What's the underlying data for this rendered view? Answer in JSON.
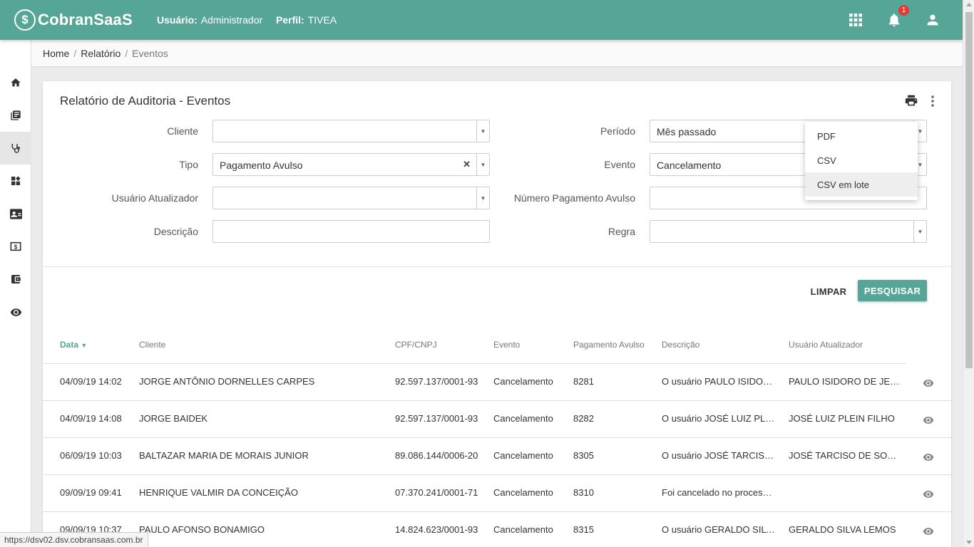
{
  "header": {
    "logo_text": "CobranSaaS",
    "user_label": "Usuário:",
    "user_value": "Administrador",
    "profile_label": "Perfil:",
    "profile_value": "TIVEA",
    "notification_count": "1",
    "color": "#56a697"
  },
  "breadcrumb": {
    "items": [
      "Home",
      "Relatório",
      "Eventos"
    ]
  },
  "sidebar": {
    "icons": [
      "home-icon",
      "book-icon",
      "stethoscope-icon",
      "dashboard-icon",
      "contact-card-icon",
      "money-icon",
      "wallet-icon",
      "eye-icon"
    ],
    "active_index": 2
  },
  "page": {
    "title": "Relatório de Auditoria - Eventos"
  },
  "filters": {
    "cliente": {
      "label": "Cliente",
      "value": ""
    },
    "tipo": {
      "label": "Tipo",
      "value": "Pagamento Avulso"
    },
    "usuario": {
      "label": "Usuário Atualizador",
      "value": ""
    },
    "descricao": {
      "label": "Descrição",
      "value": ""
    },
    "periodo": {
      "label": "Período",
      "value": "Mês passado"
    },
    "evento": {
      "label": "Evento",
      "value": "Cancelamento"
    },
    "numero": {
      "label": "Número Pagamento Avulso",
      "value": ""
    },
    "regra": {
      "label": "Regra",
      "value": ""
    }
  },
  "actions": {
    "clear": "LIMPAR",
    "search": "PESQUISAR"
  },
  "export_menu": {
    "items": [
      "PDF",
      "CSV",
      "CSV em lote"
    ],
    "hovered": "CSV em lote"
  },
  "table": {
    "headers": [
      "Data",
      "Cliente",
      "CPF/CNPJ",
      "Evento",
      "Pagamento Avulso",
      "Descrição",
      "Usuário Atualizador"
    ],
    "sort_column": "Data",
    "rows": [
      [
        "04/09/19 14:02",
        "JORGE ANTÔNIO DORNELLES CARPES",
        "92.597.137/0001-93",
        "Cancelamento",
        "8281",
        "O usuário PAULO ISIDOR…",
        "PAULO ISIDORO DE JESUS"
      ],
      [
        "04/09/19 14:08",
        "JORGE BAIDEK",
        "92.597.137/0001-93",
        "Cancelamento",
        "8282",
        "O usuário JOSÉ LUIZ PLEI…",
        "JOSÉ LUIZ PLEIN FILHO"
      ],
      [
        "06/09/19 10:03",
        "BALTAZAR MARIA DE MORAIS JUNIOR",
        "89.086.144/0006-20",
        "Cancelamento",
        "8305",
        "O usuário JOSÉ TARCISO …",
        "JOSÉ TARCISO DE SOUZA"
      ],
      [
        "09/09/19 09:41",
        "HENRIQUE VALMIR DA CONCEIÇÃO",
        "07.370.241/0001-71",
        "Cancelamento",
        "8310",
        "Foi cancelado no process…",
        ""
      ],
      [
        "09/09/19 10:37",
        "PAULO AFONSO BONAMIGO",
        "14.824.623/0001-93",
        "Cancelamento",
        "8315",
        "O usuário GERALDO SILV…",
        "GERALDO SILVA LEMOS"
      ]
    ]
  },
  "status_url": "https://dsv02.dsv.cobransaas.com.br"
}
